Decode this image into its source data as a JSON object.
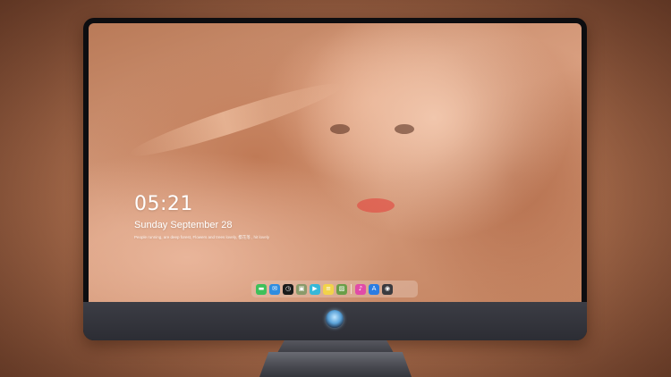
{
  "lockscreen": {
    "time": "05:21",
    "date": "Sunday September  28",
    "quote": "People running, are deep forest, Flowers and trees lovely, 樱花落 , hit lovely"
  },
  "dock": {
    "apps": [
      {
        "name": "messages-icon",
        "color": "#3ec05a",
        "glyph": "▬"
      },
      {
        "name": "mail-icon",
        "color": "#2f8de0",
        "glyph": "✉"
      },
      {
        "name": "clock-icon",
        "color": "#1b1b1b",
        "glyph": "◷"
      },
      {
        "name": "photo-viewer-icon",
        "color": "#8a9a6a",
        "glyph": "▣"
      },
      {
        "name": "video-icon",
        "color": "#36b8d8",
        "glyph": "▶"
      },
      {
        "name": "notes-icon",
        "color": "#f2d34a",
        "glyph": "≡"
      },
      {
        "name": "gallery-icon",
        "color": "#6a9e48",
        "glyph": "▨"
      }
    ],
    "tray": [
      {
        "name": "music-icon",
        "color": "#e14ba8",
        "glyph": "♪"
      },
      {
        "name": "app-store-icon",
        "color": "#2a7ce2",
        "glyph": "A"
      },
      {
        "name": "camera-icon",
        "color": "#3a3a3e",
        "glyph": "◉"
      }
    ]
  },
  "colors": {
    "bezel": "#0d0d10",
    "chin": "#34353c",
    "dock_bg": "rgba(230,200,185,0.45)"
  }
}
